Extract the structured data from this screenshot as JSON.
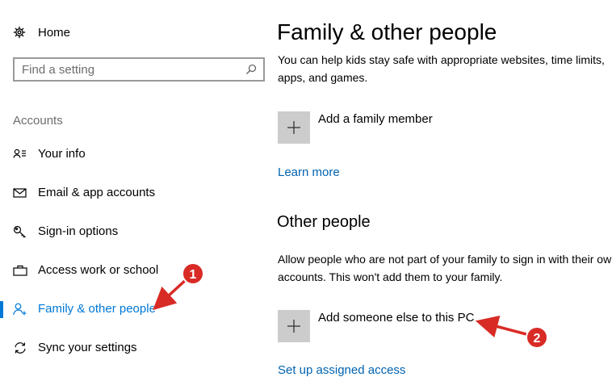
{
  "sidebar": {
    "home_label": "Home",
    "search": {
      "placeholder": "Find a setting",
      "value": ""
    },
    "section_header": "Accounts",
    "items": [
      {
        "label": "Your info",
        "icon": "contact-card-icon",
        "active": false
      },
      {
        "label": "Email & app accounts",
        "icon": "mail-icon",
        "active": false
      },
      {
        "label": "Sign-in options",
        "icon": "key-icon",
        "active": false
      },
      {
        "label": "Access work or school",
        "icon": "briefcase-icon",
        "active": false
      },
      {
        "label": "Family & other people",
        "icon": "person-add-icon",
        "active": true
      },
      {
        "label": "Sync your settings",
        "icon": "sync-icon",
        "active": false
      }
    ]
  },
  "main": {
    "title": "Family & other people",
    "family_description": "You can help kids stay safe with appropriate websites, time limits, apps, and games.",
    "add_family_label": "Add a family member",
    "learn_more_label": "Learn more",
    "other_people_header": "Other people",
    "other_people_description": "Allow people who are not part of your family to sign in with their own accounts. This won't add them to your family.",
    "add_other_label": "Add someone else to this PC",
    "assigned_access_label": "Set up assigned access"
  },
  "annotations": {
    "badge_1": "1",
    "badge_2": "2",
    "badge_color": "#d92b26"
  },
  "colors": {
    "accent": "#0078d7",
    "link": "#0063b1",
    "plus_tile": "#cccccc"
  }
}
